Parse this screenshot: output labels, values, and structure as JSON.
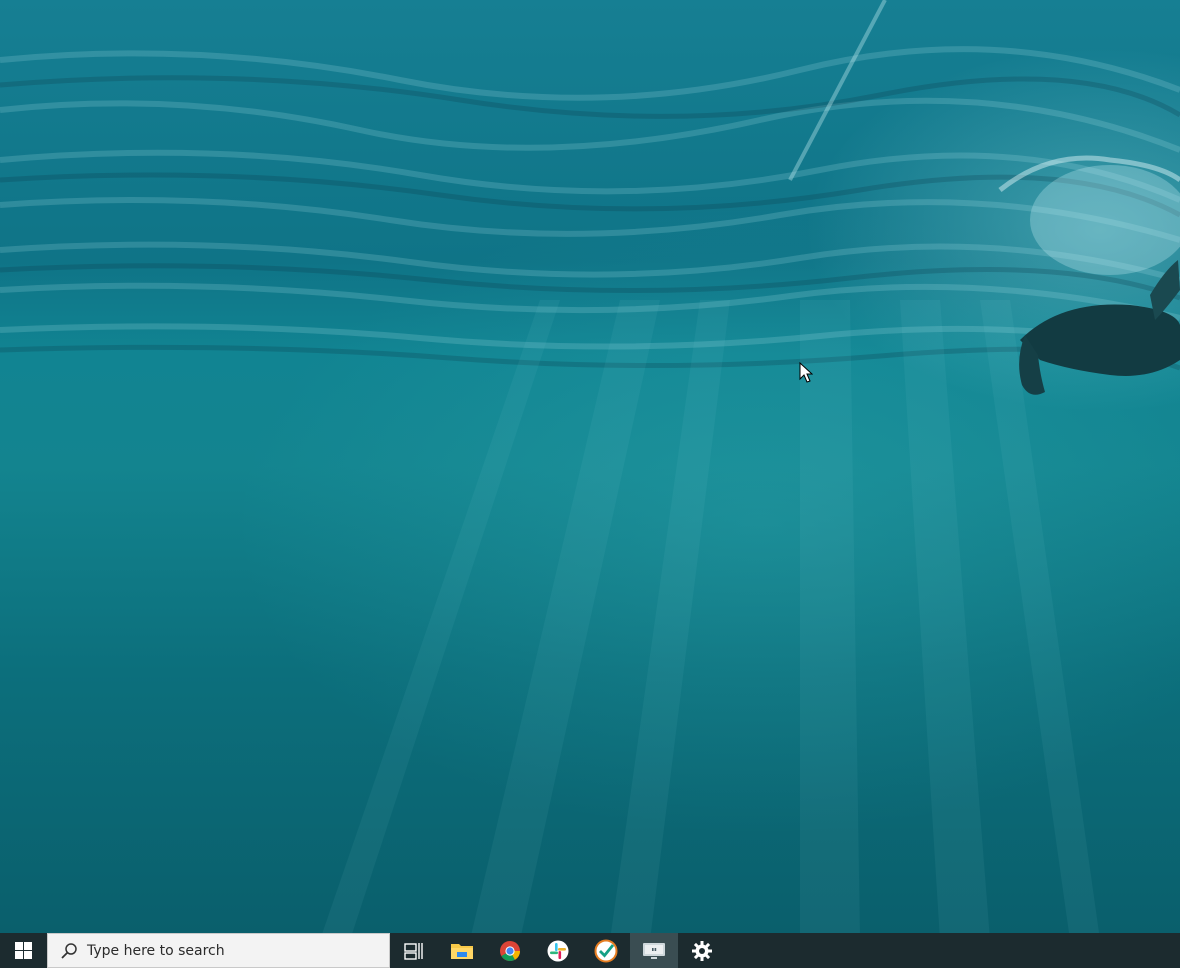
{
  "desktop": {
    "wallpaper": "underwater-swimmer",
    "colors": {
      "water_top": "#167f93",
      "water_mid": "#13848f",
      "water_bottom": "#0a5f6c"
    }
  },
  "taskbar": {
    "background": "#1c2b2f",
    "search": {
      "placeholder": "Type here to search"
    },
    "icons": [
      "windows-start-icon",
      "search-icon",
      "task-view-icon",
      "file-explorer-icon",
      "chrome-icon",
      "slack-icon",
      "check-app-icon",
      "remote-desktop-icon",
      "settings-icon"
    ],
    "active_app": "remote-desktop-icon"
  }
}
